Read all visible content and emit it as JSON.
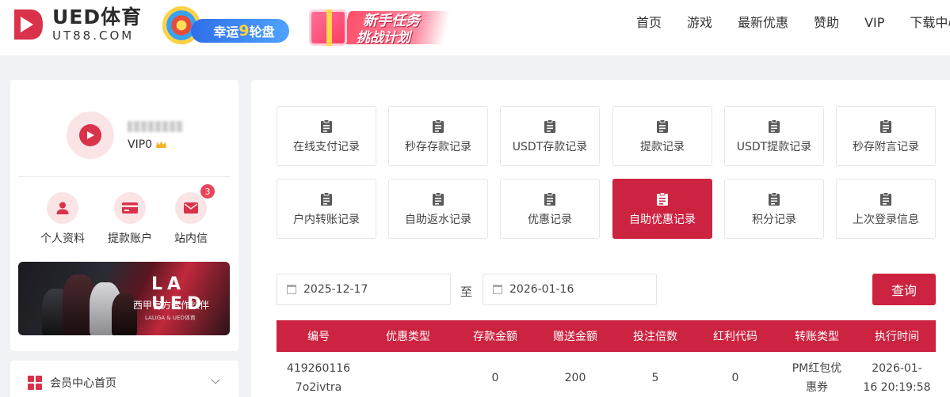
{
  "brand": {
    "name": "UED体育",
    "domain": "UT88.COM",
    "accent": "#cc2340"
  },
  "promos": {
    "wheel": {
      "prefix": "幸运",
      "number": "9",
      "suffix": "轮盘"
    },
    "newbie": {
      "line1": "新手任务",
      "line2": "挑战计划"
    }
  },
  "nav": [
    "首页",
    "游戏",
    "最新优惠",
    "赞助",
    "VIP",
    "下载中心"
  ],
  "profile": {
    "vip_level": "VIP0",
    "quick_links": [
      {
        "label": "个人资料",
        "icon": "user-icon"
      },
      {
        "label": "提款账户",
        "icon": "card-icon"
      },
      {
        "label": "站内信",
        "icon": "mail-icon",
        "badge": "3"
      }
    ],
    "banner": {
      "logos": "LA UED",
      "caption": "西甲官方合作伙伴",
      "small": "LALIGA & UED体育"
    }
  },
  "menu": {
    "item": "会员中心首页"
  },
  "records": [
    {
      "label": "在线支付记录",
      "icon": "clipboard-icon"
    },
    {
      "label": "秒存存款记录",
      "icon": "clipboard-icon"
    },
    {
      "label": "USDT存款记录",
      "icon": "clipboard-icon"
    },
    {
      "label": "提款记录",
      "icon": "clipboard-icon"
    },
    {
      "label": "USDT提款记录",
      "icon": "clipboard-icon"
    },
    {
      "label": "秒存附言记录",
      "icon": "clipboard-icon"
    },
    {
      "label": "户内转账记录",
      "icon": "clipboard-icon"
    },
    {
      "label": "自助返水记录",
      "icon": "clipboard-icon"
    },
    {
      "label": "优惠记录",
      "icon": "clipboard-icon"
    },
    {
      "label": "自助优惠记录",
      "icon": "clipboard-icon",
      "active": true
    },
    {
      "label": "积分记录",
      "icon": "clipboard-icon"
    },
    {
      "label": "上次登录信息",
      "icon": "clipboard-icon"
    }
  ],
  "filter": {
    "start_date": "2025-12-17",
    "separator": "至",
    "end_date": "2026-01-16",
    "query_label": "查询"
  },
  "table": {
    "headers": [
      "编号",
      "优惠类型",
      "存款金额",
      "赠送金额",
      "投注倍数",
      "红利代码",
      "转账类型",
      "执行时间"
    ],
    "rows": [
      {
        "id_line1": "419260116",
        "id_line2": "7o2ivtra",
        "promo_type": "",
        "deposit": "0",
        "bonus": "200",
        "multiplier": "5",
        "code": "0",
        "transfer_line1": "PM红包优",
        "transfer_line2": "惠券",
        "time_line1": "2026-01-",
        "time_line2": "16 20:19:58"
      }
    ]
  }
}
